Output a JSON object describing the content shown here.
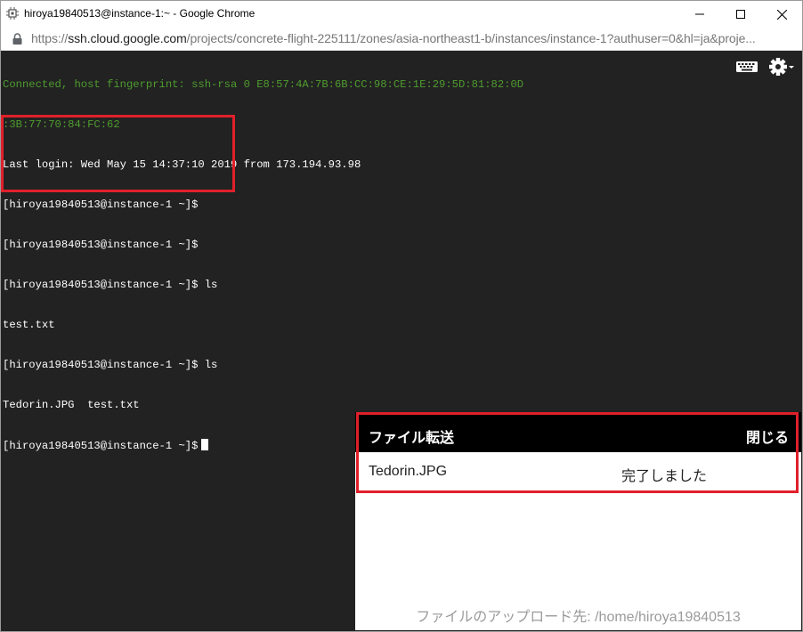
{
  "window": {
    "title": "hiroya19840513@instance-1:~ - Google Chrome"
  },
  "address": {
    "url_scheme": "https://",
    "url_host": "ssh.cloud.google.com",
    "url_path": "/projects/concrete-flight-225111/zones/asia-northeast1-b/instances/instance-1?authuser=0&hl=ja&proje..."
  },
  "terminal": {
    "lines": [
      "Connected, host fingerprint: ssh-rsa 0 E8:57:4A:7B:6B:CC:98:CE:1E:29:5D:81:82:0D",
      ":3B:77:70:84:FC:62",
      "Last login: Wed May 15 14:37:10 2019 from 173.194.93.98",
      "[hiroya19840513@instance-1 ~]$",
      "[hiroya19840513@instance-1 ~]$",
      "[hiroya19840513@instance-1 ~]$ ls",
      "test.txt",
      "[hiroya19840513@instance-1 ~]$ ls",
      "Tedorin.JPG  test.txt",
      "[hiroya19840513@instance-1 ~]$"
    ],
    "fingerprint_color": "#4f9c2f"
  },
  "toolbar": {
    "keyboard_icon": "keyboard-icon",
    "settings_icon": "gear-icon"
  },
  "transfer": {
    "title": "ファイル転送",
    "close_label": "閉じる",
    "file_name": "Tedorin.JPG",
    "status": "完了しました",
    "destination": "ファイルのアップロード先: /home/hiroya19840513"
  },
  "colors": {
    "highlight": "#e0202a",
    "terminal_bg": "#222222"
  }
}
